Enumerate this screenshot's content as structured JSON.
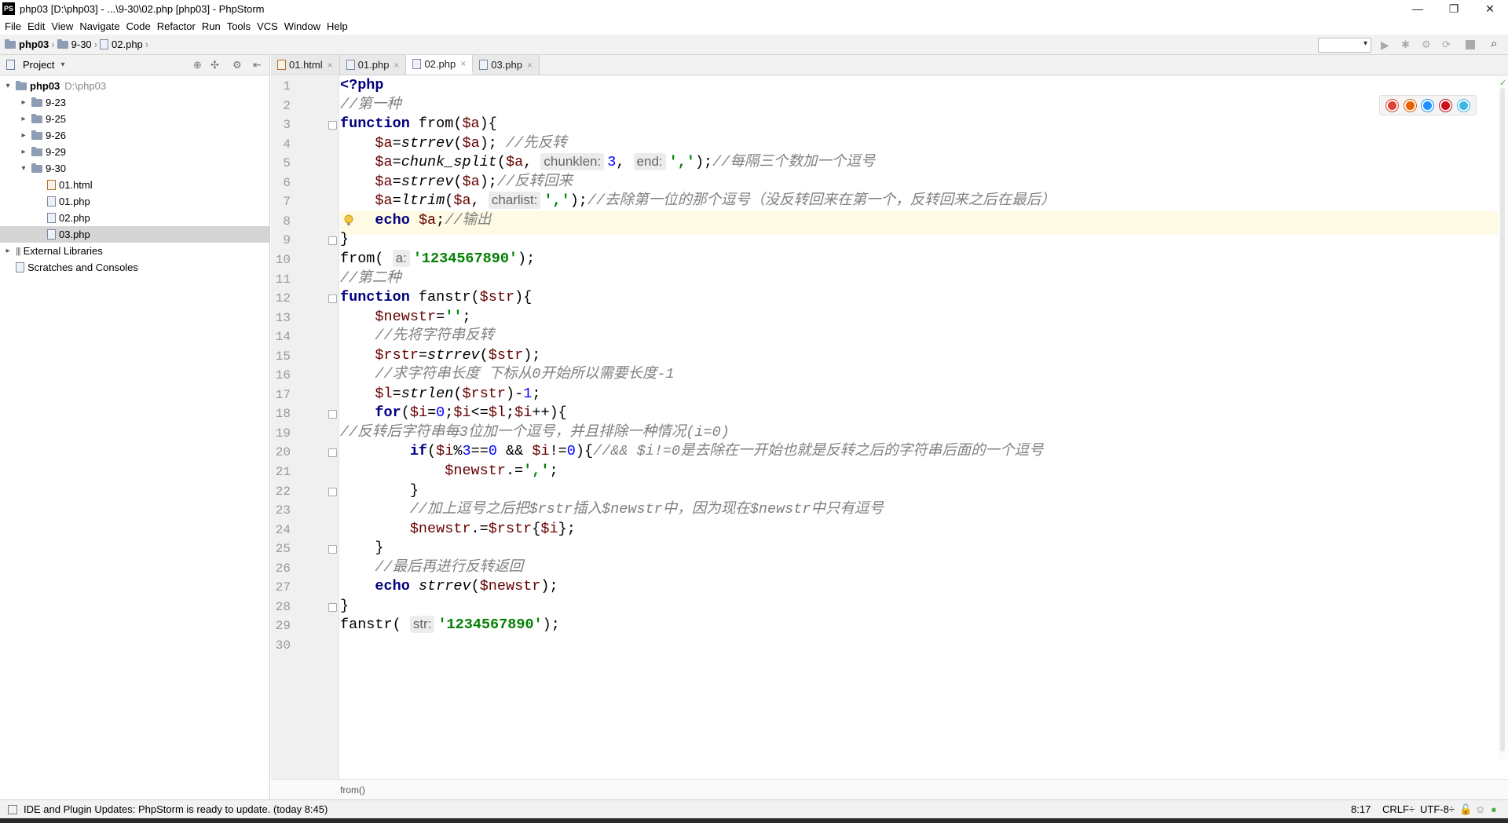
{
  "window": {
    "title": "php03 [D:\\php03] - ...\\9-30\\02.php [php03] - PhpStorm",
    "logo": "PS"
  },
  "menu": [
    "File",
    "Edit",
    "View",
    "Navigate",
    "Code",
    "Refactor",
    "Run",
    "Tools",
    "VCS",
    "Window",
    "Help"
  ],
  "breadcrumb": [
    "php03",
    "9-30",
    "02.php"
  ],
  "project": {
    "label": "Project",
    "tree": [
      {
        "label": "php03",
        "extra": "D:\\php03",
        "depth": 0,
        "arrow": "▾",
        "type": "root"
      },
      {
        "label": "9-23",
        "depth": 1,
        "arrow": "▸",
        "type": "folder"
      },
      {
        "label": "9-25",
        "depth": 1,
        "arrow": "▸",
        "type": "folder"
      },
      {
        "label": "9-26",
        "depth": 1,
        "arrow": "▸",
        "type": "folder"
      },
      {
        "label": "9-29",
        "depth": 1,
        "arrow": "▸",
        "type": "folder"
      },
      {
        "label": "9-30",
        "depth": 1,
        "arrow": "▾",
        "type": "folder"
      },
      {
        "label": "01.html",
        "depth": 2,
        "arrow": "",
        "type": "html"
      },
      {
        "label": "01.php",
        "depth": 2,
        "arrow": "",
        "type": "php"
      },
      {
        "label": "02.php",
        "depth": 2,
        "arrow": "",
        "type": "php"
      },
      {
        "label": "03.php",
        "depth": 2,
        "arrow": "",
        "type": "php",
        "selected": true
      },
      {
        "label": "External Libraries",
        "depth": 0,
        "arrow": "▸",
        "type": "lib"
      },
      {
        "label": "Scratches and Consoles",
        "depth": 0,
        "arrow": "",
        "type": "scratch"
      }
    ]
  },
  "tabs": [
    {
      "label": "01.html",
      "type": "html",
      "active": false
    },
    {
      "label": "01.php",
      "type": "php",
      "active": false
    },
    {
      "label": "02.php",
      "type": "php",
      "active": true
    },
    {
      "label": "03.php",
      "type": "php",
      "active": false
    }
  ],
  "editor": {
    "current_line": 8,
    "line_numbers": [
      "1",
      "2",
      "3",
      "4",
      "5",
      "6",
      "7",
      "8",
      "9",
      "10",
      "11",
      "12",
      "13",
      "14",
      "15",
      "16",
      "17",
      "18",
      "19",
      "20",
      "21",
      "22",
      "23",
      "24",
      "25",
      "26",
      "27",
      "28",
      "29",
      "30"
    ],
    "lines": [
      [
        {
          "t": "<?php",
          "c": "kw"
        }
      ],
      [
        {
          "t": "//第一种",
          "c": "cm"
        }
      ],
      [
        {
          "t": "function",
          "c": "kw"
        },
        {
          "t": " from("
        },
        {
          "t": "$a",
          "c": "var"
        },
        {
          "t": "){"
        }
      ],
      [
        {
          "t": "    "
        },
        {
          "t": "$a",
          "c": "var"
        },
        {
          "t": "="
        },
        {
          "t": "strrev",
          "c": "fn"
        },
        {
          "t": "("
        },
        {
          "t": "$a",
          "c": "var"
        },
        {
          "t": "); "
        },
        {
          "t": "//先反转",
          "c": "cm"
        }
      ],
      [
        {
          "t": "    "
        },
        {
          "t": "$a",
          "c": "var"
        },
        {
          "t": "="
        },
        {
          "t": "chunk_split",
          "c": "fn"
        },
        {
          "t": "("
        },
        {
          "t": "$a",
          "c": "var"
        },
        {
          "t": ", "
        },
        {
          "t": "chunklen:",
          "c": "hint"
        },
        {
          "t": "3",
          "c": "num"
        },
        {
          "t": ", "
        },
        {
          "t": "end:",
          "c": "hint"
        },
        {
          "t": "','",
          "c": "str"
        },
        {
          "t": ");"
        },
        {
          "t": "//每隔三个数加一个逗号",
          "c": "cm"
        }
      ],
      [
        {
          "t": "    "
        },
        {
          "t": "$a",
          "c": "var"
        },
        {
          "t": "="
        },
        {
          "t": "strrev",
          "c": "fn"
        },
        {
          "t": "("
        },
        {
          "t": "$a",
          "c": "var"
        },
        {
          "t": ");"
        },
        {
          "t": "//反转回来",
          "c": "cm"
        }
      ],
      [
        {
          "t": "    "
        },
        {
          "t": "$a",
          "c": "var"
        },
        {
          "t": "="
        },
        {
          "t": "ltrim",
          "c": "fn"
        },
        {
          "t": "("
        },
        {
          "t": "$a",
          "c": "var"
        },
        {
          "t": ", "
        },
        {
          "t": "charlist:",
          "c": "hint"
        },
        {
          "t": "','",
          "c": "str"
        },
        {
          "t": ");"
        },
        {
          "t": "//去除第一位的那个逗号（没反转回来在第一个，反转回来之后在最后）",
          "c": "cm"
        }
      ],
      [
        {
          "t": "    "
        },
        {
          "t": "echo",
          "c": "kw"
        },
        {
          "t": " "
        },
        {
          "t": "$a",
          "c": "var"
        },
        {
          "t": ";"
        },
        {
          "t": "//输出",
          "c": "cm"
        }
      ],
      [
        {
          "t": "}"
        }
      ],
      [
        {
          "t": "from( "
        },
        {
          "t": "a:",
          "c": "hint"
        },
        {
          "t": "'1234567890'",
          "c": "str"
        },
        {
          "t": ");"
        }
      ],
      [
        {
          "t": "//第二种",
          "c": "cm"
        }
      ],
      [
        {
          "t": "function",
          "c": "kw"
        },
        {
          "t": " fanstr("
        },
        {
          "t": "$str",
          "c": "var"
        },
        {
          "t": "){"
        }
      ],
      [
        {
          "t": "    "
        },
        {
          "t": "$newstr",
          "c": "var"
        },
        {
          "t": "="
        },
        {
          "t": "''",
          "c": "str"
        },
        {
          "t": ";"
        }
      ],
      [
        {
          "t": "    "
        },
        {
          "t": "//先将字符串反转",
          "c": "cm"
        }
      ],
      [
        {
          "t": "    "
        },
        {
          "t": "$rstr",
          "c": "var"
        },
        {
          "t": "="
        },
        {
          "t": "strrev",
          "c": "fn"
        },
        {
          "t": "("
        },
        {
          "t": "$str",
          "c": "var"
        },
        {
          "t": ");"
        }
      ],
      [
        {
          "t": "    "
        },
        {
          "t": "//求字符串长度 下标从0开始所以需要长度-1",
          "c": "cm"
        }
      ],
      [
        {
          "t": "    "
        },
        {
          "t": "$l",
          "c": "var"
        },
        {
          "t": "="
        },
        {
          "t": "strlen",
          "c": "fn"
        },
        {
          "t": "("
        },
        {
          "t": "$rstr",
          "c": "var"
        },
        {
          "t": ")-"
        },
        {
          "t": "1",
          "c": "num"
        },
        {
          "t": ";"
        }
      ],
      [
        {
          "t": "    "
        },
        {
          "t": "for",
          "c": "kw"
        },
        {
          "t": "("
        },
        {
          "t": "$i",
          "c": "var"
        },
        {
          "t": "="
        },
        {
          "t": "0",
          "c": "num"
        },
        {
          "t": ";"
        },
        {
          "t": "$i",
          "c": "var"
        },
        {
          "t": "<="
        },
        {
          "t": "$l",
          "c": "var"
        },
        {
          "t": ";"
        },
        {
          "t": "$i",
          "c": "var"
        },
        {
          "t": "++){"
        }
      ],
      [
        {
          "t": "//反转后字符串每3位加一个逗号，并且排除一种情况(i=0)",
          "c": "cm"
        }
      ],
      [
        {
          "t": "        "
        },
        {
          "t": "if",
          "c": "kw"
        },
        {
          "t": "("
        },
        {
          "t": "$i",
          "c": "var"
        },
        {
          "t": "%"
        },
        {
          "t": "3",
          "c": "num"
        },
        {
          "t": "=="
        },
        {
          "t": "0",
          "c": "num"
        },
        {
          "t": " && "
        },
        {
          "t": "$i",
          "c": "var"
        },
        {
          "t": "!="
        },
        {
          "t": "0",
          "c": "num"
        },
        {
          "t": "){"
        },
        {
          "t": "//&& $i!=0是去除在一开始也就是反转之后的字符串后面的一个逗号",
          "c": "cm"
        }
      ],
      [
        {
          "t": "            "
        },
        {
          "t": "$newstr",
          "c": "var"
        },
        {
          "t": ".="
        },
        {
          "t": "','",
          "c": "str"
        },
        {
          "t": ";"
        }
      ],
      [
        {
          "t": "        }"
        }
      ],
      [
        {
          "t": "        "
        },
        {
          "t": "//加上逗号之后把$rstr插入$newstr中，因为现在$newstr中只有逗号",
          "c": "cm"
        }
      ],
      [
        {
          "t": "        "
        },
        {
          "t": "$newstr",
          "c": "var"
        },
        {
          "t": ".="
        },
        {
          "t": "$rstr",
          "c": "var"
        },
        {
          "t": "{"
        },
        {
          "t": "$i",
          "c": "var"
        },
        {
          "t": "};"
        }
      ],
      [
        {
          "t": "    }"
        }
      ],
      [
        {
          "t": "    "
        },
        {
          "t": "//最后再进行反转返回",
          "c": "cm"
        }
      ],
      [
        {
          "t": "    "
        },
        {
          "t": "echo",
          "c": "kw"
        },
        {
          "t": " "
        },
        {
          "t": "strrev",
          "c": "fn"
        },
        {
          "t": "("
        },
        {
          "t": "$newstr",
          "c": "var"
        },
        {
          "t": ");"
        }
      ],
      [
        {
          "t": "}"
        }
      ],
      [
        {
          "t": "fanstr( "
        },
        {
          "t": "str:",
          "c": "hint"
        },
        {
          "t": "'1234567890'",
          "c": "str"
        },
        {
          "t": ");"
        }
      ],
      []
    ],
    "fold_lines": [
      3,
      9,
      12,
      18,
      20,
      22,
      25,
      28
    ]
  },
  "browsers": [
    {
      "name": "chrome-icon",
      "color": "#db4437"
    },
    {
      "name": "firefox-icon",
      "color": "#e66000"
    },
    {
      "name": "safari-icon",
      "color": "#1e90ff"
    },
    {
      "name": "opera-icon",
      "color": "#cc0f16"
    },
    {
      "name": "ie-icon",
      "color": "#3fb6e8"
    }
  ],
  "code_breadcrumb": "from()",
  "status": {
    "message": "IDE and Plugin Updates: PhpStorm is ready to update. (today 8:45)",
    "position": "8:17",
    "line_sep": "CRLF÷",
    "encoding": "UTF-8÷"
  }
}
